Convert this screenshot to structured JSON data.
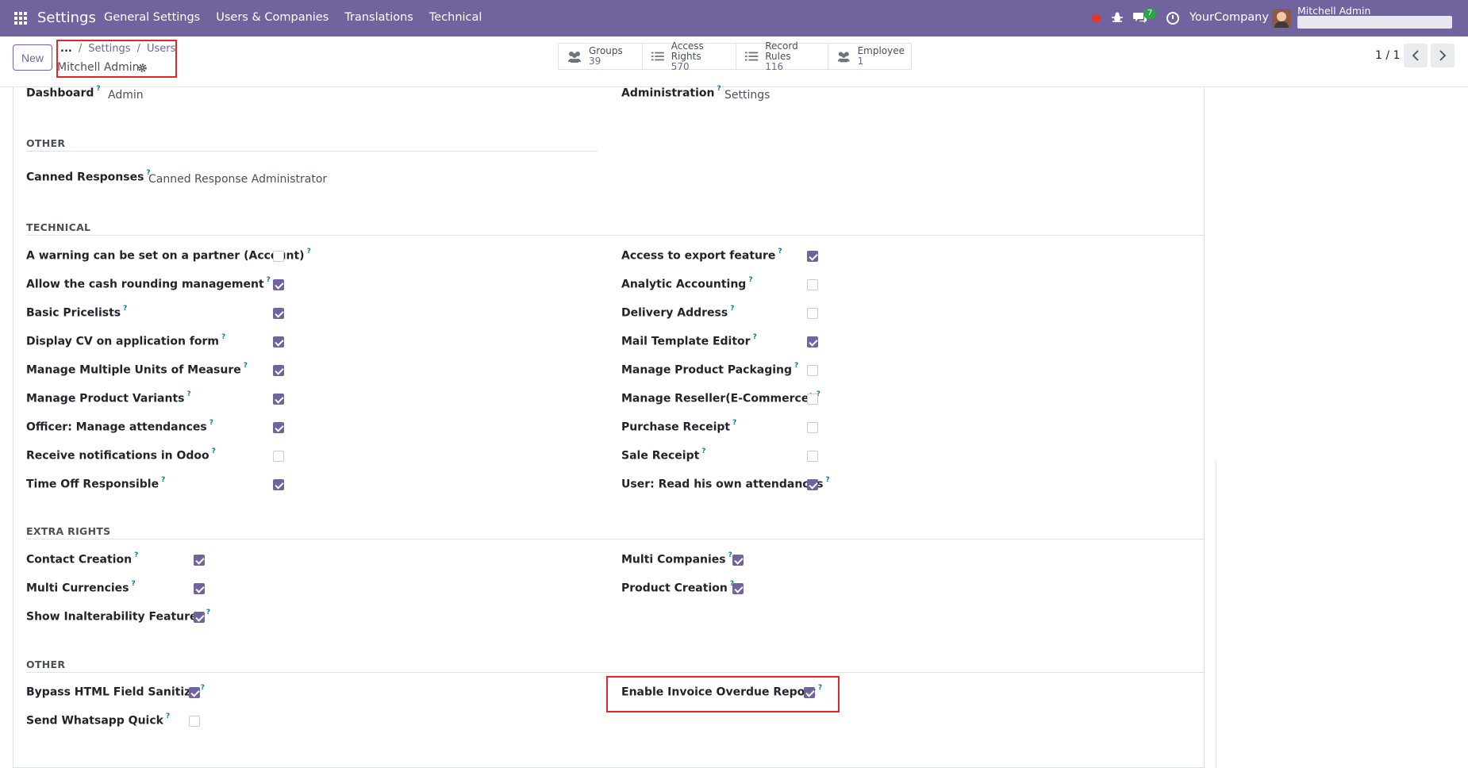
{
  "navbar": {
    "brand": "Settings",
    "menu": [
      "General Settings",
      "Users & Companies",
      "Translations",
      "Technical"
    ],
    "chat_count": "7",
    "company": "YourCompany",
    "user": "Mitchell Admin",
    "bg_color": "#71639e"
  },
  "control": {
    "new_label": "New",
    "breadcrumb": [
      "...",
      "Settings",
      "Users"
    ],
    "record_title": "Mitchell Admin",
    "smart_buttons": [
      {
        "label": "Groups",
        "count": "39",
        "icon": "users-icon"
      },
      {
        "label": "Access Rights",
        "count": "570",
        "icon": "list-icon"
      },
      {
        "label": "Record Rules",
        "count": "116",
        "icon": "list-icon"
      },
      {
        "label": "Employee",
        "count": "1",
        "icon": "users-icon"
      }
    ],
    "pager": "1 / 1"
  },
  "top_fields": {
    "dashboard_label": "Dashboard",
    "dashboard_value": "Admin",
    "administration_label": "Administration",
    "administration_value": "Settings"
  },
  "other_section": {
    "title": "OTHER",
    "canned_label": "Canned Responses",
    "canned_value": "Canned Response Administrator"
  },
  "technical": {
    "title": "TECHNICAL",
    "left": [
      {
        "label": "A warning can be set on a partner (Account)",
        "checked": false
      },
      {
        "label": "Allow the cash rounding management",
        "checked": true
      },
      {
        "label": "Basic Pricelists",
        "checked": true
      },
      {
        "label": "Display CV on application form",
        "checked": true
      },
      {
        "label": "Manage Multiple Units of Measure",
        "checked": true
      },
      {
        "label": "Manage Product Variants",
        "checked": true
      },
      {
        "label": "Officer: Manage attendances",
        "checked": true
      },
      {
        "label": "Receive notifications in Odoo",
        "checked": false
      },
      {
        "label": "Time Off Responsible",
        "checked": true
      }
    ],
    "right": [
      {
        "label": "Access to export feature",
        "checked": true
      },
      {
        "label": "Analytic Accounting",
        "checked": false
      },
      {
        "label": "Delivery Address",
        "checked": false
      },
      {
        "label": "Mail Template Editor",
        "checked": true
      },
      {
        "label": "Manage Product Packaging",
        "checked": false
      },
      {
        "label": "Manage Reseller(E-Commerce)",
        "checked": false
      },
      {
        "label": "Purchase Receipt",
        "checked": false
      },
      {
        "label": "Sale Receipt",
        "checked": false
      },
      {
        "label": "User: Read his own attendances",
        "checked": true
      }
    ]
  },
  "extra_rights": {
    "title": "EXTRA RIGHTS",
    "left": [
      {
        "label": "Contact Creation",
        "checked": true
      },
      {
        "label": "Multi Currencies",
        "checked": true
      },
      {
        "label": "Show Inalterability Features",
        "checked": true
      }
    ],
    "right": [
      {
        "label": "Multi Companies",
        "checked": true
      },
      {
        "label": "Product Creation",
        "checked": true
      }
    ]
  },
  "other2": {
    "title": "OTHER",
    "left": [
      {
        "label": "Bypass HTML Field Sanitize",
        "checked": true
      },
      {
        "label": "Send Whatsapp Quick",
        "checked": false
      }
    ],
    "right": [
      {
        "label": "Enable Invoice Overdue Report",
        "checked": true
      }
    ]
  },
  "help_mark": "?"
}
